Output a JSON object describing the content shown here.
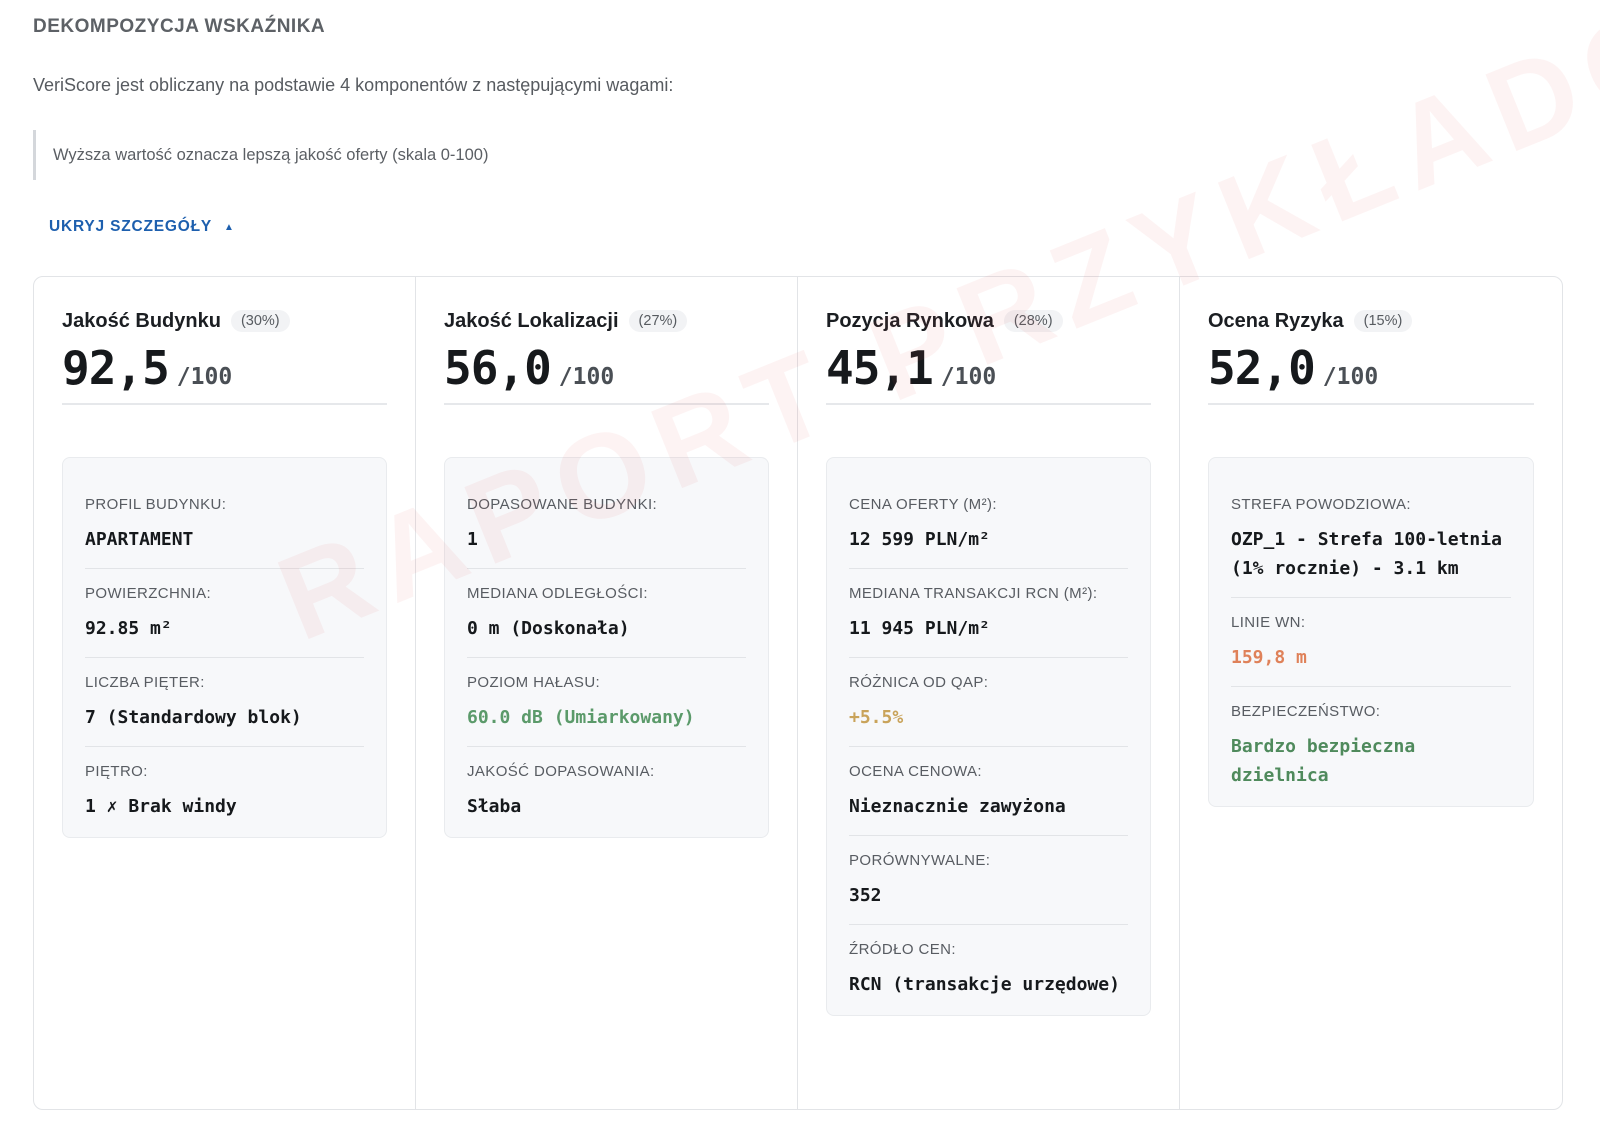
{
  "section_title": "DEKOMPOZYCJA WSKAŹNIKA",
  "intro": "VeriScore jest obliczany na podstawie 4 komponentów z następującymi wagami:",
  "note": "Wyższa wartość oznacza lepszą jakość oferty (skala 0-100)",
  "toggle": {
    "label": "UKRYJ SZCZEGÓŁY",
    "arrow": "▲"
  },
  "watermark": "RAPORT PRZYKŁADOWY",
  "score_max": "/100",
  "colors": {
    "accent": "#1d5fae",
    "good": "#5b9a6a",
    "moderate": "#c9a35a",
    "warning": "#df8159",
    "safe": "#4f8a5c"
  },
  "components": [
    {
      "name": "Jakość Budynku",
      "weight": "(30%)",
      "score": "92,5",
      "details": [
        {
          "label": "PROFIL BUDYNKU:",
          "value": "APARTAMENT"
        },
        {
          "label": "POWIERZCHNIA:",
          "value": "92.85 m²"
        },
        {
          "label": "LICZBA PIĘTER:",
          "value": "7 (Standardowy blok)"
        },
        {
          "label": "PIĘTRO:",
          "value": "1 ✗ Brak windy"
        }
      ]
    },
    {
      "name": "Jakość Lokalizacji",
      "weight": "(27%)",
      "score": "56,0",
      "details": [
        {
          "label": "DOPASOWANE BUDYNKI:",
          "value": "1"
        },
        {
          "label": "MEDIANA ODLEGŁOŚCI:",
          "value": "0 m (Doskonała)"
        },
        {
          "label": "POZIOM HAŁASU:",
          "value": "60.0 dB (Umiarkowany)"
        },
        {
          "label": "JAKOŚĆ DOPASOWANIA:",
          "value": "Słaba"
        }
      ]
    },
    {
      "name": "Pozycja Rynkowa",
      "weight": "(28%)",
      "score": "45,1",
      "details": [
        {
          "label": "CENA OFERTY (M²):",
          "value": "12 599 PLN/m²"
        },
        {
          "label": "MEDIANA TRANSAKCJI RCN (M²):",
          "value": "11 945 PLN/m²"
        },
        {
          "label": "RÓŻNICA OD QAP:",
          "value": "+5.5%"
        },
        {
          "label": "OCENA CENOWA:",
          "value": "Nieznacznie zawyżona"
        },
        {
          "label": "PORÓWNYWALNE:",
          "value": "352"
        },
        {
          "label": "ŹRÓDŁO CEN:",
          "value": "RCN (transakcje urzędowe)"
        }
      ]
    },
    {
      "name": "Ocena Ryzyka",
      "weight": "(15%)",
      "score": "52,0",
      "details": [
        {
          "label": "STREFA POWODZIOWA:",
          "value": "OZP_1 - Strefa 100-letnia (1% rocznie) - 3.1 km"
        },
        {
          "label": "LINIE WN:",
          "value": "159,8 m"
        },
        {
          "label": "BEZPIECZEŃSTWO:",
          "value": "Bardzo bezpieczna dzielnica"
        }
      ]
    }
  ]
}
